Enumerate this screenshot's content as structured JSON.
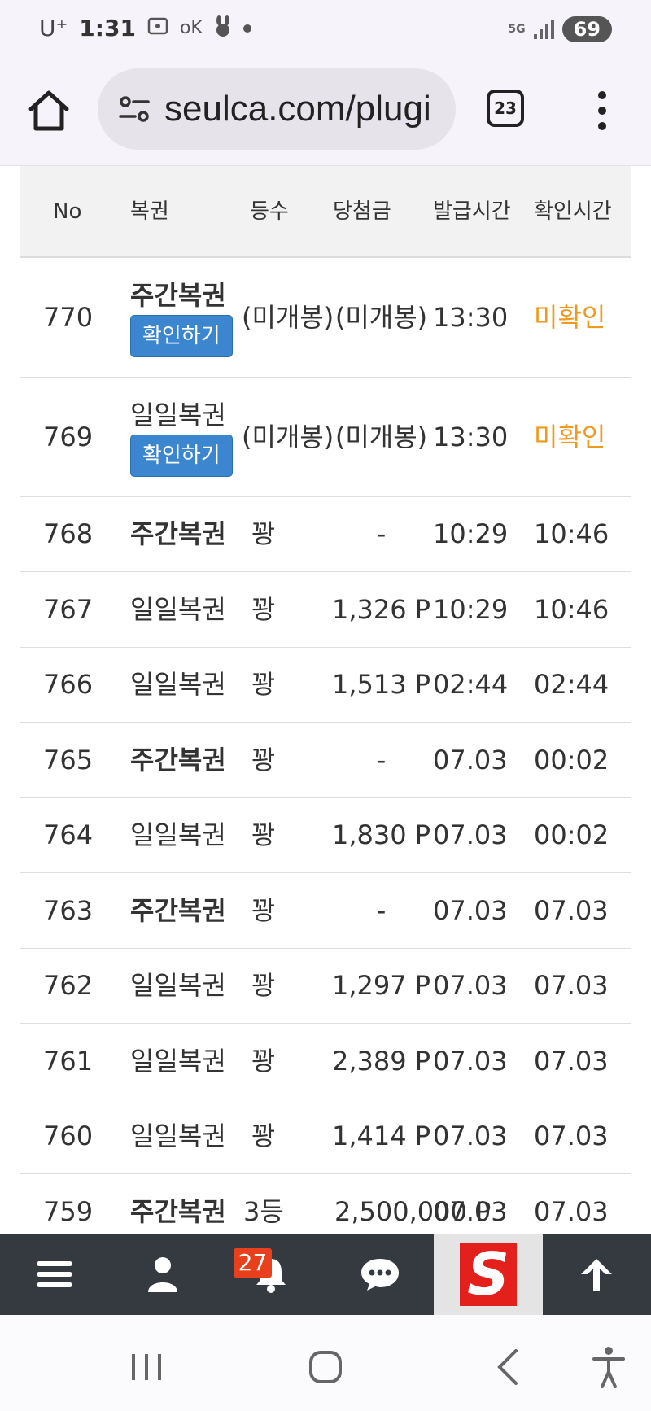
{
  "status_bar": {
    "carrier": "U⁺",
    "time": "1:31",
    "ok_label": "oK",
    "network": "5G",
    "battery": "69"
  },
  "browser": {
    "url": "seulca.com/plugi",
    "tab_count": "23"
  },
  "table": {
    "headers": {
      "no": "No",
      "ticket": "복권",
      "rank": "등수",
      "prize": "당첨금",
      "issued": "발급시간",
      "checked": "확인시간"
    },
    "check_button_label": "확인하기",
    "rows": [
      {
        "no": "770",
        "ticket": "주간복권",
        "rank": "(미개봉)",
        "prize": "(미개봉)",
        "issued": "13:30",
        "checked": "미확인"
      },
      {
        "no": "769",
        "ticket": "일일복권",
        "rank": "(미개봉)",
        "prize": "(미개봉)",
        "issued": "13:30",
        "checked": "미확인"
      },
      {
        "no": "768",
        "ticket": "주간복권",
        "rank": "꽝",
        "prize": "-",
        "issued": "10:29",
        "checked": "10:46"
      },
      {
        "no": "767",
        "ticket": "일일복권",
        "rank": "꽝",
        "prize": "1,326 P",
        "issued": "10:29",
        "checked": "10:46"
      },
      {
        "no": "766",
        "ticket": "일일복권",
        "rank": "꽝",
        "prize": "1,513 P",
        "issued": "02:44",
        "checked": "02:44"
      },
      {
        "no": "765",
        "ticket": "주간복권",
        "rank": "꽝",
        "prize": "-",
        "issued": "07.03",
        "checked": "00:02"
      },
      {
        "no": "764",
        "ticket": "일일복권",
        "rank": "꽝",
        "prize": "1,830 P",
        "issued": "07.03",
        "checked": "00:02"
      },
      {
        "no": "763",
        "ticket": "주간복권",
        "rank": "꽝",
        "prize": "-",
        "issued": "07.03",
        "checked": "07.03"
      },
      {
        "no": "762",
        "ticket": "일일복권",
        "rank": "꽝",
        "prize": "1,297 P",
        "issued": "07.03",
        "checked": "07.03"
      },
      {
        "no": "761",
        "ticket": "일일복권",
        "rank": "꽝",
        "prize": "2,389 P",
        "issued": "07.03",
        "checked": "07.03"
      },
      {
        "no": "760",
        "ticket": "일일복권",
        "rank": "꽝",
        "prize": "1,414 P",
        "issued": "07.03",
        "checked": "07.03"
      },
      {
        "no": "759",
        "ticket": "주간복권",
        "rank": "3등",
        "prize": "2,500,000 P",
        "issued": "07.03",
        "checked": "07.03"
      }
    ]
  },
  "bottom_nav": {
    "notification_count": "27",
    "logo_letter": "S"
  },
  "colors": {
    "check_button": "#3b86cf",
    "unconfirmed": "#ee9a1e",
    "nav_bg": "#343a40",
    "badge": "#e8401c",
    "logo_red": "#e3201b"
  }
}
